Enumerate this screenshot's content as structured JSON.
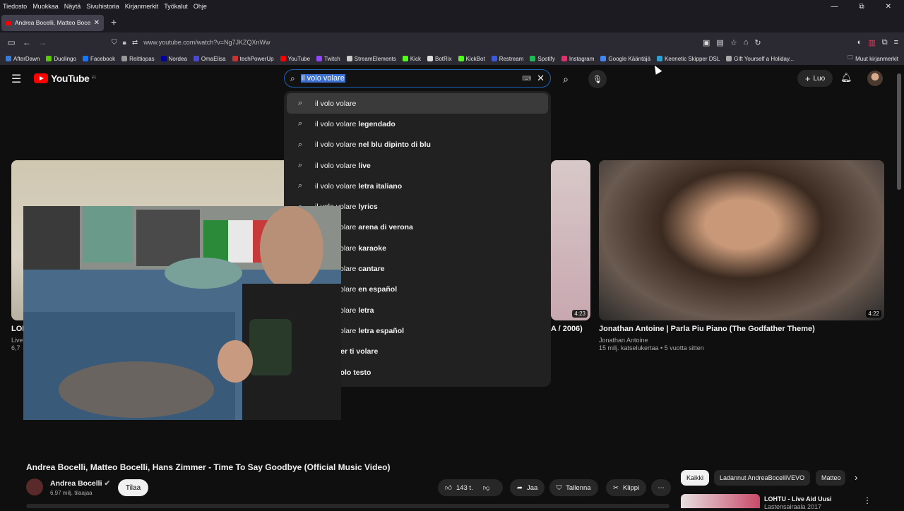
{
  "menubar": {
    "items": [
      "Tiedosto",
      "Muokkaa",
      "Näytä",
      "Sivuhistoria",
      "Kirjanmerkit",
      "Työkalut",
      "Ohje"
    ],
    "window_controls": [
      "—",
      "⧉",
      "✕"
    ]
  },
  "tab": {
    "title": "Andrea Bocelli, Matteo Bocelli, ⁝",
    "close": "✕",
    "new": "+"
  },
  "address_bar": {
    "url": "www.youtube.com/watch?v=Ng7JKZQXnWw"
  },
  "bookmarks": [
    {
      "label": "AfterDawn",
      "color": "#3a7bd5"
    },
    {
      "label": "Duolingo",
      "color": "#58cc02"
    },
    {
      "label": "Facebook",
      "color": "#1877f2"
    },
    {
      "label": "Reittiopas",
      "color": "#999999"
    },
    {
      "label": "Nordea",
      "color": "#0000a0"
    },
    {
      "label": "OmaElisa",
      "color": "#4a4ad0"
    },
    {
      "label": "techPowerUp",
      "color": "#c83232"
    },
    {
      "label": "YouTube",
      "color": "#ff0000"
    },
    {
      "label": "Twitch",
      "color": "#9146ff"
    },
    {
      "label": "StreamElements",
      "color": "#cccccc"
    },
    {
      "label": "Kick",
      "color": "#53fc18"
    },
    {
      "label": "BotRix",
      "color": "#dddddd"
    },
    {
      "label": "KickBot",
      "color": "#53fc18"
    },
    {
      "label": "Restream",
      "color": "#3a5ad8"
    },
    {
      "label": "Spotify",
      "color": "#1db954"
    },
    {
      "label": "Instagram",
      "color": "#e1306c"
    },
    {
      "label": "Google Kääntäjä",
      "color": "#4285f4"
    },
    {
      "label": "Keenetic Skipper DSL",
      "color": "#2aa0d8"
    },
    {
      "label": "Gift Yourself a Holiday...",
      "color": "#aaaaaa"
    }
  ],
  "bookmarks_other": "Muut kirjanmerkit",
  "youtube": {
    "logo_text": "YouTube",
    "region": "FI",
    "search_query": "il volo volare",
    "create_label": "Luo",
    "suggestions": [
      {
        "base": "il volo volare",
        "extra": ""
      },
      {
        "base": "il volo volare ",
        "extra": "legendado"
      },
      {
        "base": "il volo volare ",
        "extra": "nel blu dipinto di blu"
      },
      {
        "base": "il volo volare ",
        "extra": "live"
      },
      {
        "base": "il volo volare ",
        "extra": "letra italiano"
      },
      {
        "base": "il volo volare ",
        "extra": "lyrics"
      },
      {
        "base": "il volo volare ",
        "extra": "arena di verona"
      },
      {
        "base": "il volo volare ",
        "extra": "karaoke"
      },
      {
        "base": "il volo volare ",
        "extra": "cantare"
      },
      {
        "base": "il volo volare ",
        "extra": "en español"
      },
      {
        "base": "il volo volare ",
        "extra": "letra"
      },
      {
        "base": "il volo volare ",
        "extra": "letra español"
      },
      {
        "base": "il volo ",
        "extra": "per ti volare"
      },
      {
        "base": "il volo ",
        "extra": "volo testo"
      }
    ],
    "cards": [
      {
        "title": "LOH",
        "meta1": "Live",
        "meta2": "6,7",
        "duration": ""
      },
      {
        "title": "A / 2006)",
        "meta1": "",
        "meta2": "",
        "duration": "4:23"
      },
      {
        "title": "Jonathan Antoine | Parla Piu Piano (The Godfather Theme)",
        "meta1": "Jonathan Antoine",
        "meta2": "15 milj. katselukertaa • 5 vuotta sitten",
        "duration": "4:22"
      }
    ],
    "video": {
      "title": "Andrea Bocelli, Matteo Bocelli, Hans Zimmer - Time To Say Goodbye (Official Music Video)",
      "channel": "Andrea Bocelli",
      "subs": "6,97 milj. tilaajaa",
      "subscribe": "Tilaa",
      "likes": "143 t.",
      "share": "Jaa",
      "save": "Tallenna",
      "clip": "Klippi"
    },
    "chips": [
      "Kaikki",
      "Ladannut AndreaBocelliVEVO",
      "Matteo"
    ],
    "side_video": {
      "title1": "LOHTU - Live Aid Uusi",
      "title2": "Lastensairaala 2017"
    }
  }
}
